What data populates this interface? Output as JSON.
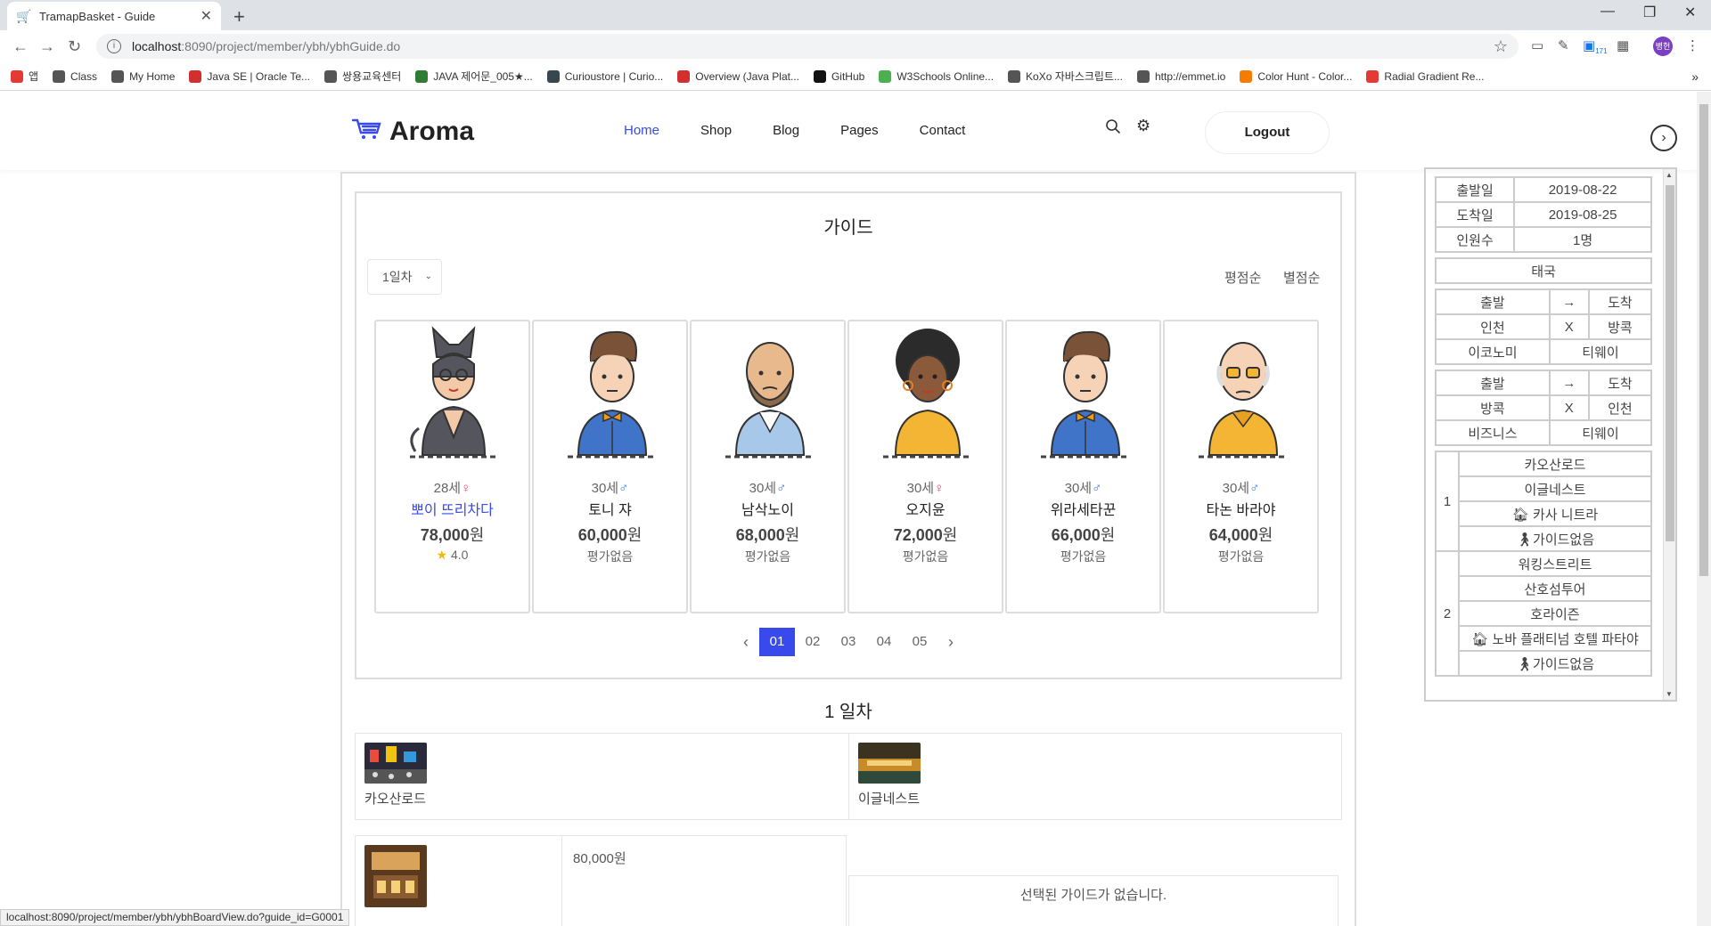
{
  "browser": {
    "tab_title": "TramapBasket - Guide",
    "url_host": "localhost",
    "url_rest": ":8090/project/member/ybh/ybhGuide.do",
    "profile_label": "병헌",
    "ext_badge": "171",
    "bookmarks": [
      {
        "label": "앱",
        "color": "#e53935"
      },
      {
        "label": "Class",
        "color": "#555"
      },
      {
        "label": "My Home",
        "color": "#555"
      },
      {
        "label": "Java SE | Oracle Te...",
        "color": "#d32f2f"
      },
      {
        "label": "쌍용교육센터",
        "color": "#555"
      },
      {
        "label": "JAVA 제어문_005★...",
        "color": "#2e7d32"
      },
      {
        "label": "Curioustore | Curio...",
        "color": "#37474f"
      },
      {
        "label": "Overview (Java Plat...",
        "color": "#d32f2f"
      },
      {
        "label": "GitHub",
        "color": "#111"
      },
      {
        "label": "W3Schools Online...",
        "color": "#4caf50"
      },
      {
        "label": "KoXo 자바스크립트...",
        "color": "#555"
      },
      {
        "label": "http://emmet.io",
        "color": "#555"
      },
      {
        "label": "Color Hunt - Color...",
        "color": "#f57c00"
      },
      {
        "label": "Radial Gradient Re...",
        "color": "#e53935"
      }
    ]
  },
  "site": {
    "logo": "Aroma",
    "nav": [
      "Home",
      "Shop",
      "Blog",
      "Pages",
      "Contact"
    ],
    "logout": "Logout"
  },
  "guide": {
    "title": "가이드",
    "day_select": "1일차",
    "sort_rating": "평점순",
    "sort_stars": "별점순",
    "cards": [
      {
        "age": "28세",
        "gender": "♀",
        "name": "뽀이 뜨리차다",
        "price": "78,000",
        "won": "원",
        "rating": "4.0",
        "rated": true
      },
      {
        "age": "30세",
        "gender": "♂",
        "name": "토니 쟈",
        "price": "60,000",
        "won": "원",
        "rating": "평가없음",
        "rated": false
      },
      {
        "age": "30세",
        "gender": "♂",
        "name": "남삭노이",
        "price": "68,000",
        "won": "원",
        "rating": "평가없음",
        "rated": false
      },
      {
        "age": "30세",
        "gender": "♀",
        "name": "오지윤",
        "price": "72,000",
        "won": "원",
        "rating": "평가없음",
        "rated": false
      },
      {
        "age": "30세",
        "gender": "♂",
        "name": "위라세타꾼",
        "price": "66,000",
        "won": "원",
        "rating": "평가없음",
        "rated": false
      },
      {
        "age": "30세",
        "gender": "♂",
        "name": "타논 바라야",
        "price": "64,000",
        "won": "원",
        "rating": "평가없음",
        "rated": false
      }
    ],
    "pages": [
      "01",
      "02",
      "03",
      "04",
      "05"
    ]
  },
  "day": {
    "heading": "1 일차",
    "place1": "카오산로드",
    "place2": "이글네스트",
    "hotel_price": "80,000원",
    "no_guide": "선택된 가이드가 없습니다."
  },
  "status_url": "localhost:8090/project/member/ybh/ybhBoardView.do?guide_id=G0001",
  "side": {
    "dep_label": "출발일",
    "dep_value": "2019-08-22",
    "arr_label": "도착일",
    "arr_value": "2019-08-25",
    "people_label": "인원수",
    "people_value": "1명",
    "country": "태국",
    "flight1": {
      "h1": "출발",
      "h2": "→",
      "h3": "도착",
      "from": "인천",
      "x": "X",
      "to": "방콕",
      "cls": "이코노미",
      "airline": "티웨이"
    },
    "flight2": {
      "h1": "출발",
      "h2": "→",
      "h3": "도착",
      "from": "방콕",
      "x": "X",
      "to": "인천",
      "cls": "비즈니스",
      "airline": "티웨이"
    },
    "days": [
      {
        "num": "1",
        "items": [
          "카오산로드",
          "이글네스트"
        ],
        "hotel": "카사 니트라",
        "guide": "가이드없음"
      },
      {
        "num": "2",
        "items": [
          "워킹스트리트",
          "산호섬투어",
          "호라이즌"
        ],
        "hotel": "노바 플래티넘 호텔 파타야",
        "guide": "가이드없음"
      }
    ]
  }
}
